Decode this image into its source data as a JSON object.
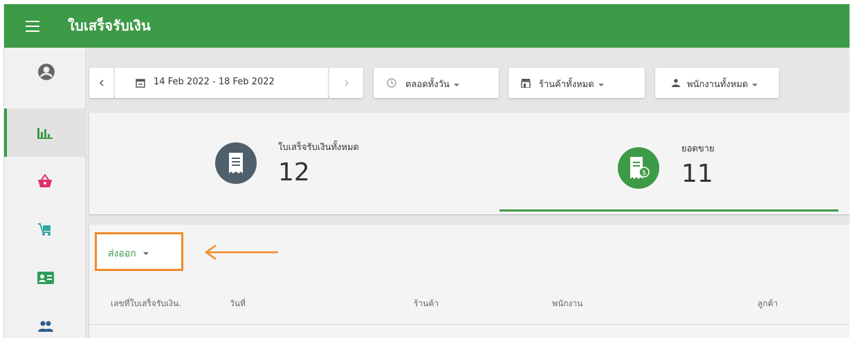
{
  "app": {
    "title": "ใบเสร็จรับเงิน"
  },
  "rail": {
    "items": [
      {
        "icon": "account-circle-icon",
        "active": false
      },
      {
        "icon": "bar-chart-icon",
        "active": true
      },
      {
        "icon": "shopping-basket-icon",
        "active": false
      },
      {
        "icon": "cart-icon",
        "active": false
      },
      {
        "icon": "contact-card-icon",
        "active": false
      },
      {
        "icon": "people-icon",
        "active": false
      }
    ]
  },
  "filters": {
    "date_range": "14 Feb 2022 - 18 Feb 2022",
    "time": "ตลอดทั้งวัน",
    "store": "ร้านค้าทั้งหมด",
    "employee": "พนักงานทั้งหมด"
  },
  "summary": {
    "receipts_label": "ใบเสร็จรับเงินทั้งหมด",
    "receipts_value": "12",
    "sales_label": "ยอดขาย",
    "sales_value": "11"
  },
  "export": {
    "label": "ส่งออก"
  },
  "table": {
    "columns": [
      "เลขที่ใบเสร็จรับเงิน.",
      "วันที่",
      "ร้านค้า",
      "พนักงาน",
      "ลูกค้า"
    ]
  },
  "colors": {
    "primary": "#3d9a47",
    "highlight": "#f08a24",
    "icon_dark": "#4a5a66"
  }
}
